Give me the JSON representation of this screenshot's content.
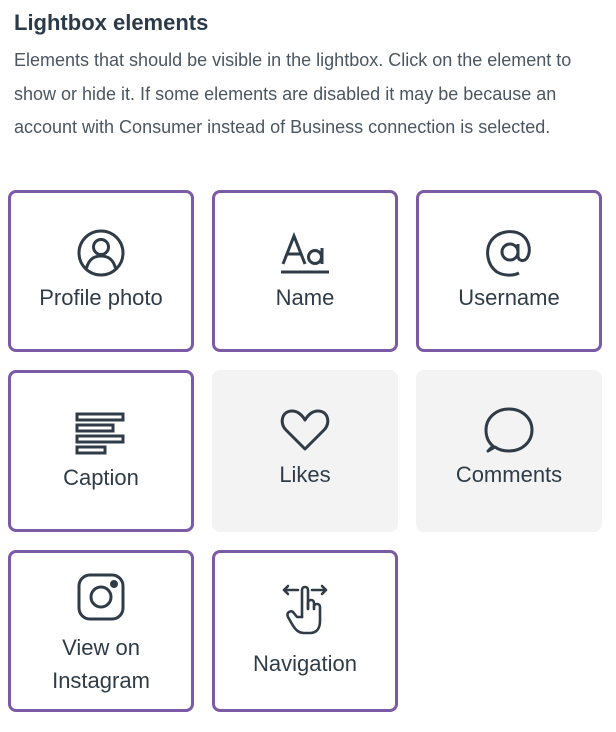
{
  "section": {
    "title": "Lightbox elements",
    "description": "Elements that should be visible in the lightbox. Click on the element to show or hide it. If some elements are disabled it may be because an account with Consumer instead of Business connection is selected."
  },
  "tiles": [
    {
      "label": "Profile photo",
      "icon": "user-circle-icon",
      "state": "enabled"
    },
    {
      "label": "Name",
      "icon": "text-aa-icon",
      "state": "enabled"
    },
    {
      "label": "Username",
      "icon": "at-sign-icon",
      "state": "enabled"
    },
    {
      "label": "Caption",
      "icon": "text-lines-icon",
      "state": "enabled"
    },
    {
      "label": "Likes",
      "icon": "heart-icon",
      "state": "disabled"
    },
    {
      "label": "Comments",
      "icon": "speech-bubble-icon",
      "state": "disabled"
    },
    {
      "label_line1": "View on",
      "label_line2": "Instagram",
      "icon": "instagram-icon",
      "state": "enabled"
    },
    {
      "label": "Navigation",
      "icon": "swipe-hand-icon",
      "state": "enabled"
    }
  ],
  "colors": {
    "accent_border": "#7b5aa6",
    "disabled_bg": "#f3f3f3",
    "icon_stroke": "#2f3c48",
    "text": "#2f3c48"
  }
}
